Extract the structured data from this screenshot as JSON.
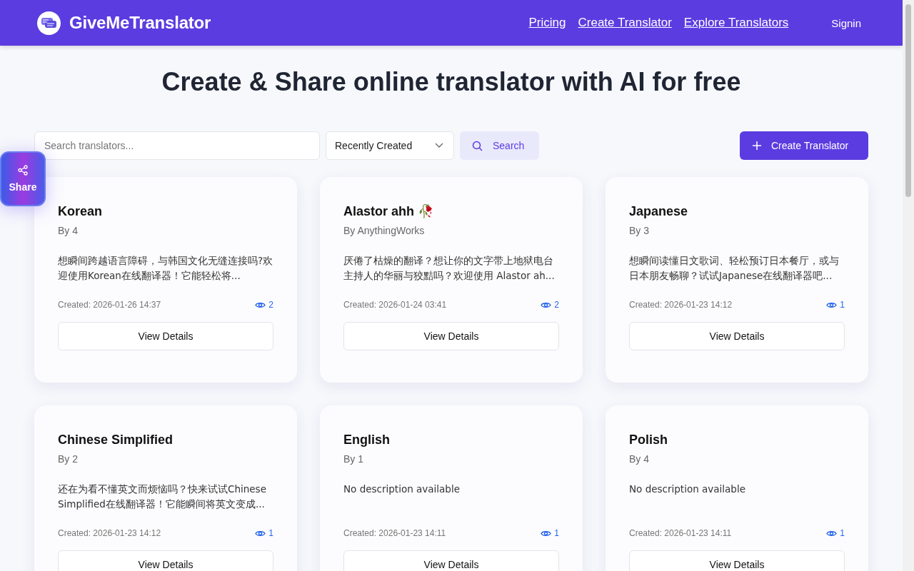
{
  "header": {
    "brand": "GiveMeTranslator",
    "nav": [
      "Pricing",
      "Create Translator",
      "Explore Translators"
    ],
    "signin": "Signin"
  },
  "hero": {
    "title": "Create & Share online translator with AI for free"
  },
  "toolbar": {
    "search": {
      "placeholder": "Search translators..."
    },
    "sort": "Recently Created",
    "search_button": "Search",
    "create_button": "Create Translator"
  },
  "share": {
    "label": "Share"
  },
  "cards": [
    {
      "title": "Korean",
      "author": "By 4",
      "description": "想瞬间跨越语言障碍，与韩国文化无缝连接吗?欢迎使用Korean在线翻译器！它能轻松将...",
      "created": "Created: 2026-01-26 14:37",
      "views": "2",
      "button": "View Details"
    },
    {
      "title": "Alastor ahh 🥀",
      "author": "By AnythingWorks",
      "description": "厌倦了枯燥的翻译？想让你的文字带上地狱电台主持人的华丽与狡黠吗？欢迎使用 Alastor ah...",
      "created": "Created: 2026-01-24 03:41",
      "views": "2",
      "button": "View Details"
    },
    {
      "title": "Japanese",
      "author": "By 3",
      "description": "想瞬间读懂日文歌词、轻松预订日本餐厅，或与日本朋友畅聊？试试Japanese在线翻译器吧...",
      "created": "Created: 2026-01-23 14:12",
      "views": "1",
      "button": "View Details"
    },
    {
      "title": "Chinese Simplified",
      "author": "By 2",
      "description": "还在为看不懂英文而烦恼吗？快来试试Chinese Simplified在线翻译器！它能瞬间将英文变成...",
      "created": "Created: 2026-01-23 14:12",
      "views": "1",
      "button": "View Details"
    },
    {
      "title": "English",
      "author": "By 1",
      "description": "No description available",
      "created": "Created: 2026-01-23 14:11",
      "views": "1",
      "button": "View Details"
    },
    {
      "title": "Polish",
      "author": "By 4",
      "description": "No description available",
      "created": "Created: 2026-01-23 14:11",
      "views": "1",
      "button": "View Details"
    }
  ]
}
